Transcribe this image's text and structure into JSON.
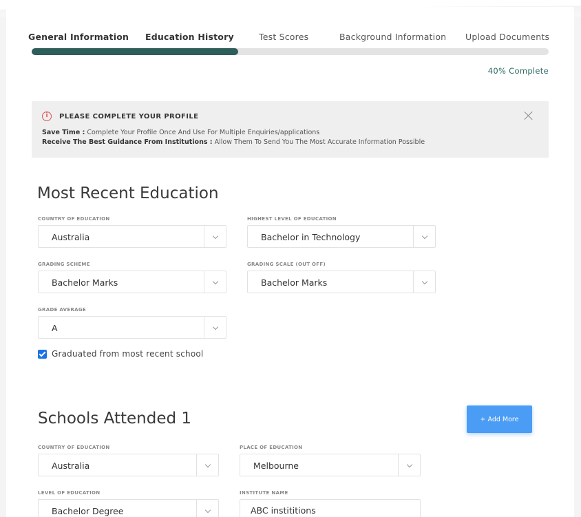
{
  "tabs": [
    {
      "label": "General Information",
      "active": true
    },
    {
      "label": "Education History",
      "active": true
    },
    {
      "label": "Test Scores",
      "active": false
    },
    {
      "label": "Background Information",
      "active": false
    },
    {
      "label": "Upload Documents",
      "active": false
    }
  ],
  "progress": {
    "value": 0.4,
    "label": "40% Complete"
  },
  "alert": {
    "icon": "info-circle-icon",
    "title": "PLEASE COMPLETE YOUR PROFILE",
    "line1_bold": "Save Time :",
    "line1_text": " Complete Your Profile Once And Use For Multiple Enquiries/applications",
    "line2_bold": "Receive The Best Guidance From Institutions :",
    "line2_text": " Allow Them To Send You The Most Accurate Information Possible",
    "close_icon": "close-icon"
  },
  "recent_education": {
    "title": "Most Recent Education",
    "country_label": "COUNTRY OF EDUCATION",
    "country_value": "Australia",
    "highest_level_label": "HIGHEST LEVEL OF EDUCATION",
    "highest_level_value": "Bachelor in Technology",
    "grading_scheme_label": "GRADING SCHEME",
    "grading_scheme_value": "Bachelor Marks",
    "grading_scale_label": "GRADING SCALE (OUT OFF)",
    "grading_scale_value": "Bachelor Marks",
    "grade_average_label": "GRADE AVERAGE",
    "grade_average_value": "A",
    "graduated_label": "Graduated from most recent school",
    "graduated_checked": true
  },
  "schools_attended": {
    "title": "Schools Attended 1",
    "add_more_label": "+ Add More",
    "country_label": "COUNTRY OF EDUCATION",
    "country_value": "Australia",
    "place_label": "PLACE OF EDUCATION",
    "place_value": "Melbourne",
    "level_label": "LEVEL OF EDUCATION",
    "level_value": "Bachelor Degree",
    "institute_label": "INSTITUTE NAME",
    "institute_value": "ABC instititions"
  },
  "colors": {
    "progress_fill": "#2e5e5a",
    "accent_blue": "#4a9cf4",
    "alert_icon": "#e05050"
  }
}
